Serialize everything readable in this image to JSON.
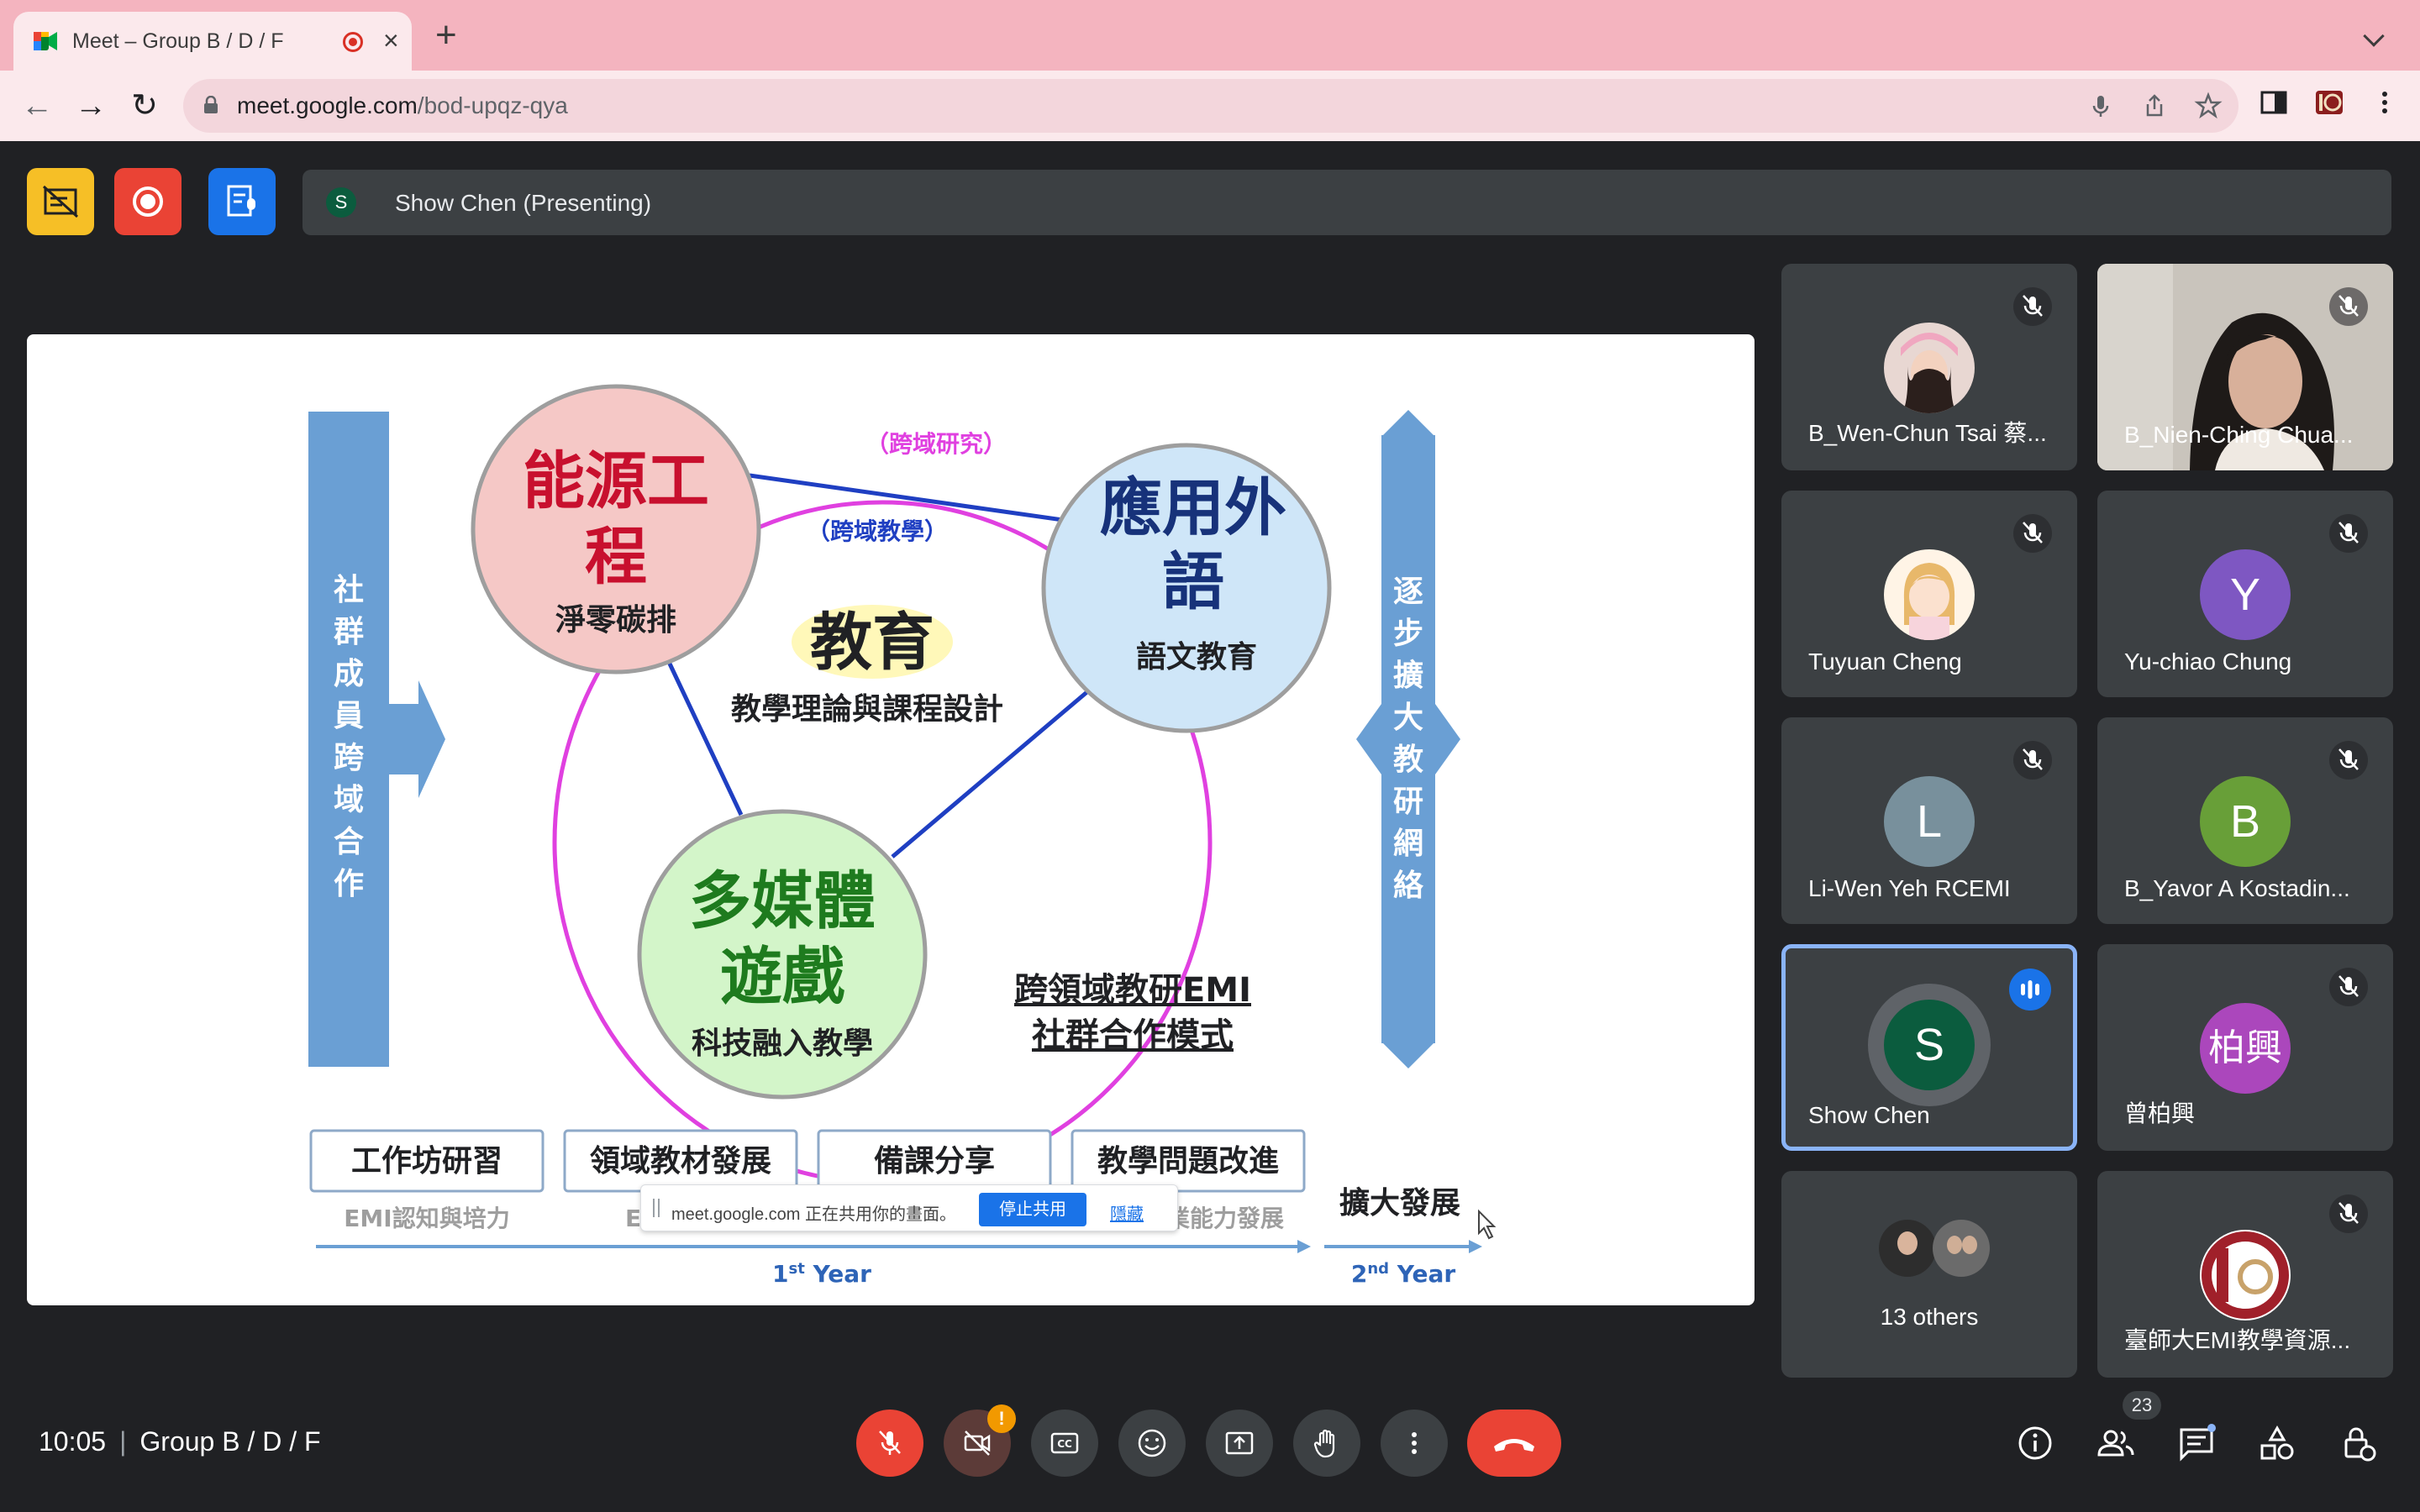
{
  "browser": {
    "tab_title": "Meet – Group B / D / F",
    "url_host": "meet.google.com",
    "url_path": "/bod-upqz-qya"
  },
  "meet": {
    "presenting_initial": "S",
    "presenting_text": "Show Chen (Presenting)",
    "time": "10:05",
    "meeting_name": "Group B / D / F",
    "participant_count": "23"
  },
  "slide": {
    "left_bar": "社群成員跨域合作",
    "right_bar": "逐步擴大教研網絡",
    "circle_energy_title": "能源工程",
    "circle_energy_title_l1": "能源工",
    "circle_energy_title_l2": "程",
    "circle_energy_sub": "淨零碳排",
    "circle_lang_title_l1": "應用外",
    "circle_lang_title_l2": "語",
    "circle_lang_sub": "語文教育",
    "circle_media_title_l1": "多媒體",
    "circle_media_title_l2": "遊戲",
    "circle_media_sub": "科技融入教學",
    "center_title": "教育",
    "center_sub": "教學理論與課程設計",
    "label_research": "（跨域研究）",
    "label_teaching": "（跨域教學）",
    "model_l1": "跨領域教研EMI",
    "model_l2": "社群合作模式",
    "boxes": [
      "工作坊研習",
      "領域教材發展",
      "備課分享",
      "教學問題改進"
    ],
    "box_subs": [
      "EMI認知與培力",
      "EM",
      "專業能力發展"
    ],
    "expand": "擴大發展",
    "year1": "1st Year",
    "year2": "2nd Year",
    "year1_num": "1",
    "year1_sup": "st",
    "year1_word": " Year",
    "year2_num": "2",
    "year2_sup": "nd",
    "year2_word": " Year"
  },
  "share_banner": {
    "message": "meet.google.com 正在共用你的畫面。",
    "stop_label": "停止共用",
    "hide_label": "隱藏"
  },
  "participants": [
    {
      "name": "B_Wen-Chun Tsai 蔡...",
      "type": "photo",
      "muted": true
    },
    {
      "name": "B_Nien-Ching Chua...",
      "type": "video",
      "muted": true
    },
    {
      "name": "Tuyuan Cheng",
      "type": "photo",
      "muted": true
    },
    {
      "name": "Yu-chiao Chung",
      "initial": "Y",
      "color": "#7e57c2",
      "muted": true
    },
    {
      "name": "Li-Wen Yeh RCEMI",
      "initial": "L",
      "color": "#78909c",
      "muted": true
    },
    {
      "name": "B_Yavor A Kostadin...",
      "initial": "B",
      "color": "#689f38",
      "muted": true
    },
    {
      "name": "Show Chen",
      "initial": "S",
      "color": "#0b5c3e",
      "muted": false,
      "speaking": true
    },
    {
      "name": "曾柏興",
      "initial": "柏興",
      "color": "#ab47bc",
      "muted": true
    },
    {
      "name": "13 others",
      "type": "group"
    },
    {
      "name": "臺師大EMI教學資源...",
      "type": "logo",
      "muted": true
    }
  ],
  "colors": {
    "meet_bg": "#202124",
    "tile_bg": "#3c4043",
    "danger": "#ea4335",
    "accent": "#1a73e8",
    "tab_bar": "#f4b4bf"
  }
}
